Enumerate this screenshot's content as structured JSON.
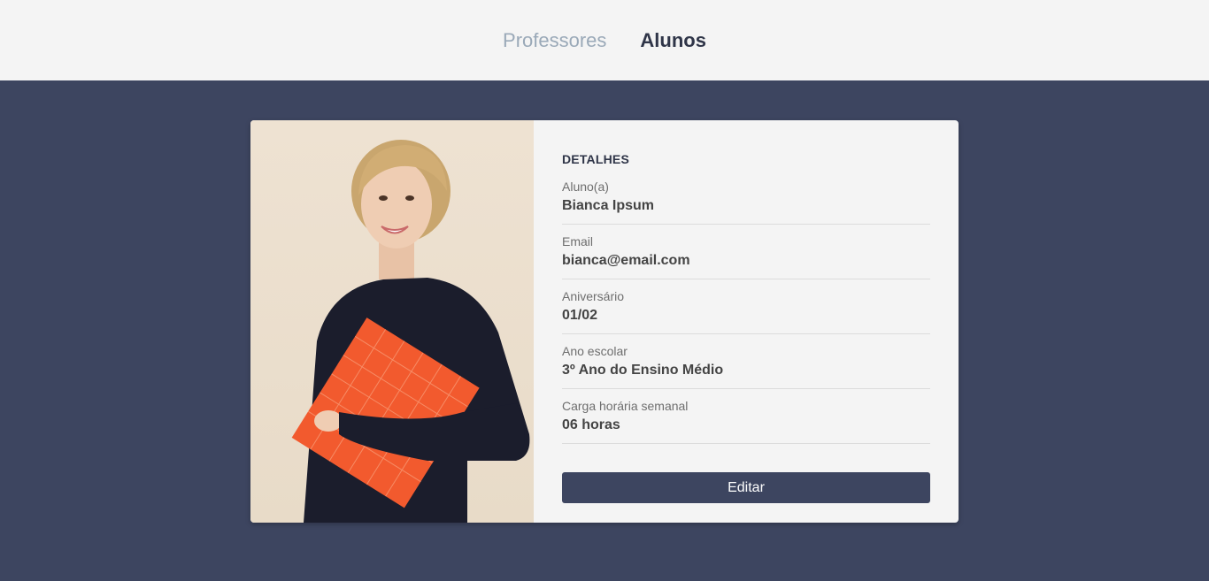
{
  "nav": {
    "items": [
      {
        "label": "Professores",
        "active": false
      },
      {
        "label": "Alunos",
        "active": true
      }
    ]
  },
  "card": {
    "section_title": "DETALHES",
    "fields": [
      {
        "label": "Aluno(a)",
        "value": "Bianca Ipsum"
      },
      {
        "label": "Email",
        "value": "bianca@email.com"
      },
      {
        "label": "Aniversário",
        "value": "01/02"
      },
      {
        "label": "Ano escolar",
        "value": "3º Ano do Ensino Médio"
      },
      {
        "label": "Carga horária semanal",
        "value": "06 horas"
      }
    ],
    "edit_label": "Editar",
    "photo_icon": "student-photo"
  },
  "colors": {
    "header_bg": "#f4f4f4",
    "page_bg": "#3d4560",
    "accent": "#3d4560",
    "nav_inactive": "#9aa9b8",
    "nav_active": "#2f3548"
  }
}
